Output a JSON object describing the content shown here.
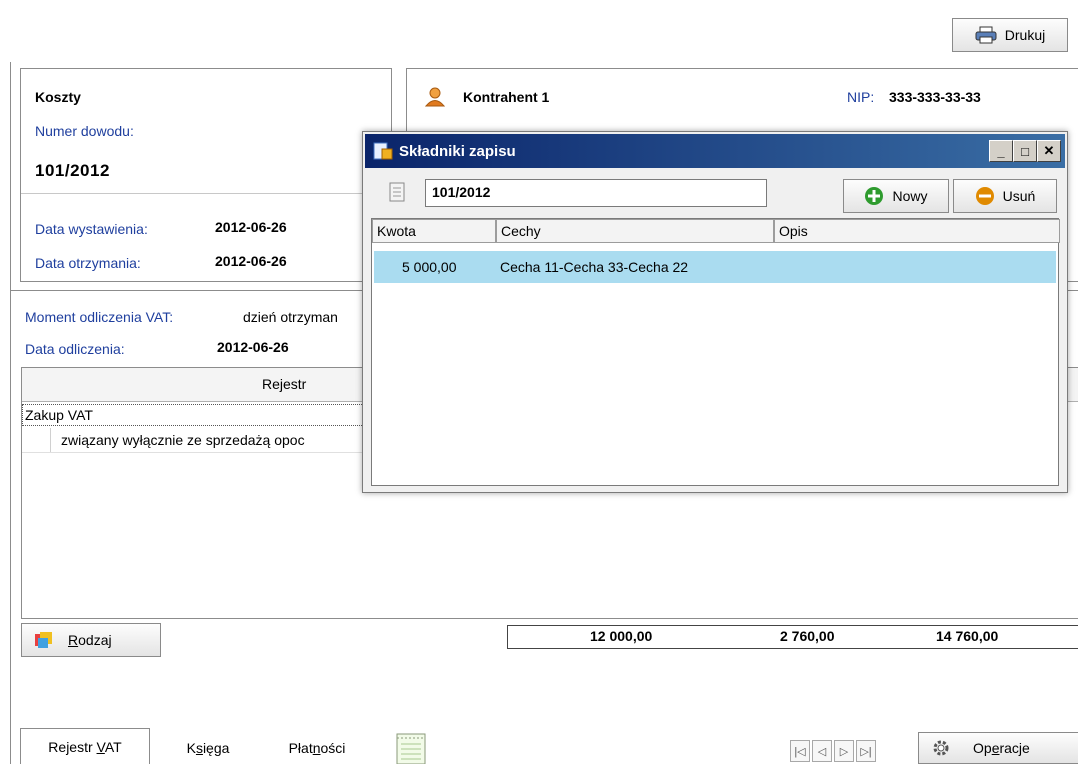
{
  "toolbar": {
    "print_label": "Drukuj"
  },
  "doc": {
    "type_label": "Koszty",
    "number_label": "Numer dowodu:",
    "number_value": "101/2012",
    "issue_date_label": "Data wystawienia:",
    "issue_date_value": "2012-06-26",
    "receipt_date_label": "Data otrzymania:",
    "receipt_date_value": "2012-06-26"
  },
  "contractor": {
    "name": "Kontrahent 1",
    "nip_label": "NIP:",
    "nip_value": "333-333-33-33"
  },
  "vat": {
    "moment_label": "Moment odliczenia VAT:",
    "moment_value": "dzień otrzyman",
    "deduction_date_label": "Data odliczenia:",
    "deduction_date_value": "2012-06-26"
  },
  "register": {
    "header": "Rejestr",
    "rows": [
      "Zakup VAT",
      "związany wyłącznie ze sprzedażą opoc"
    ]
  },
  "rodzaj_button": {
    "label": "Rodzaj",
    "underline_char": "R",
    "rest": "odzaj"
  },
  "totals": [
    "12 000,00",
    "2 760,00",
    "14 760,00"
  ],
  "tabs": [
    {
      "label": "Rejestr VAT",
      "pre": "Rejestr ",
      "u": "V",
      "post": "AT"
    },
    {
      "label": "Księga",
      "pre": "K",
      "u": "s",
      "post": "ięga"
    },
    {
      "label": "Płatności",
      "pre": "Płat",
      "u": "n",
      "post": "ości"
    }
  ],
  "operacje": {
    "label": "Operacje",
    "pre": "Op",
    "u": "e",
    "post": "racje"
  },
  "dialog": {
    "title": "Składniki zapisu",
    "doc_number": "101/2012",
    "new_label": "Nowy",
    "delete_label": "Usuń",
    "columns": [
      "Kwota",
      "Cechy",
      "Opis"
    ],
    "rows": [
      {
        "amount": "5 000,00",
        "features": "Cecha 11-Cecha 33-Cecha 22",
        "desc": ""
      }
    ]
  },
  "colors": {
    "label_blue": "#1f3f9e",
    "selected_row": "#aadcf0",
    "title_bar": "#0a246a",
    "add_green": "#2e9b2e",
    "remove_orange": "#e08a00"
  }
}
